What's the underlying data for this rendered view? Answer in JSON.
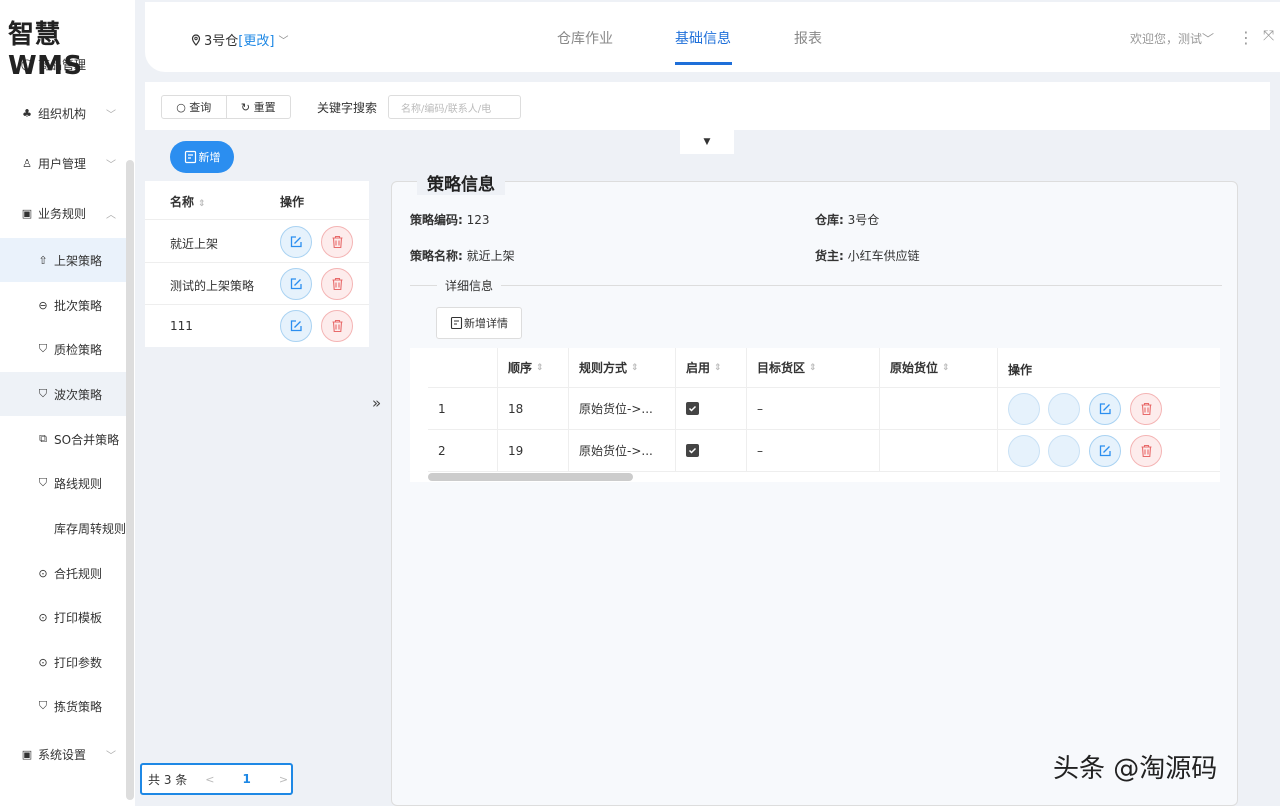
{
  "app": {
    "logo": "智慧WMS"
  },
  "header": {
    "warehouse": "3号仓",
    "change": "[更改]",
    "tabs": [
      {
        "label": "仓库作业"
      },
      {
        "label": "基础信息"
      },
      {
        "label": "报表"
      }
    ],
    "welcome": "欢迎您，测试"
  },
  "sidebar": {
    "items": [
      {
        "label": "商品管理",
        "icon": "circle-icon"
      },
      {
        "label": "组织机构",
        "icon": "org-icon"
      },
      {
        "label": "用户管理",
        "icon": "user-icon"
      },
      {
        "label": "业务规则",
        "icon": "grid-icon"
      },
      {
        "label": "上架策略",
        "icon": "upload-icon"
      },
      {
        "label": "批次策略",
        "icon": "batch-icon"
      },
      {
        "label": "质检策略",
        "icon": "shield-icon"
      },
      {
        "label": "波次策略",
        "icon": "shield-icon"
      },
      {
        "label": "SO合并策略",
        "icon": "merge-icon"
      },
      {
        "label": "路线规则",
        "icon": "shield-icon"
      },
      {
        "label": "库存周转规则",
        "icon": ""
      },
      {
        "label": "合托规则",
        "icon": "dots-icon"
      },
      {
        "label": "打印模板",
        "icon": "dots-icon"
      },
      {
        "label": "打印参数",
        "icon": "dots-icon"
      },
      {
        "label": "拣货策略",
        "icon": "shield-icon"
      },
      {
        "label": "系统设置",
        "icon": "settings-icon"
      }
    ]
  },
  "search": {
    "query_label": "查询",
    "reset_label": "重置",
    "keyword_label": "关键字搜索",
    "keyword_placeholder": "名称/编码/联系人/电"
  },
  "add_label": "新增",
  "list": {
    "columns": [
      "名称",
      "操作"
    ],
    "rows": [
      {
        "name": "就近上架"
      },
      {
        "name": "测试的上架策略"
      },
      {
        "name": "111"
      }
    ],
    "pager": {
      "total": "共 3 条",
      "page": "1",
      "prev": "<",
      "next": ">"
    }
  },
  "detail": {
    "title": "策略信息",
    "code_label": "策略编码:",
    "code": "123",
    "warehouse_label": "仓库:",
    "warehouse": "3号仓",
    "name_label": "策略名称:",
    "name": "就近上架",
    "owner_label": "货主:",
    "owner": "小红车供应链",
    "section": "详细信息",
    "add_detail": "新增详情",
    "columns": [
      "",
      "顺序",
      "规则方式",
      "启用",
      "目标货区",
      "原始货位",
      "操作"
    ],
    "rows": [
      {
        "idx": "1",
        "order": "18",
        "rule": "原始货位->...",
        "enabled": true,
        "target": "–",
        "origin": ""
      },
      {
        "idx": "2",
        "order": "19",
        "rule": "原始货位->...",
        "enabled": true,
        "target": "–",
        "origin": ""
      }
    ]
  },
  "watermark": "头条 @淘源码",
  "colors": {
    "primary": "#2b8ef0",
    "danger": "#e86a6a"
  }
}
